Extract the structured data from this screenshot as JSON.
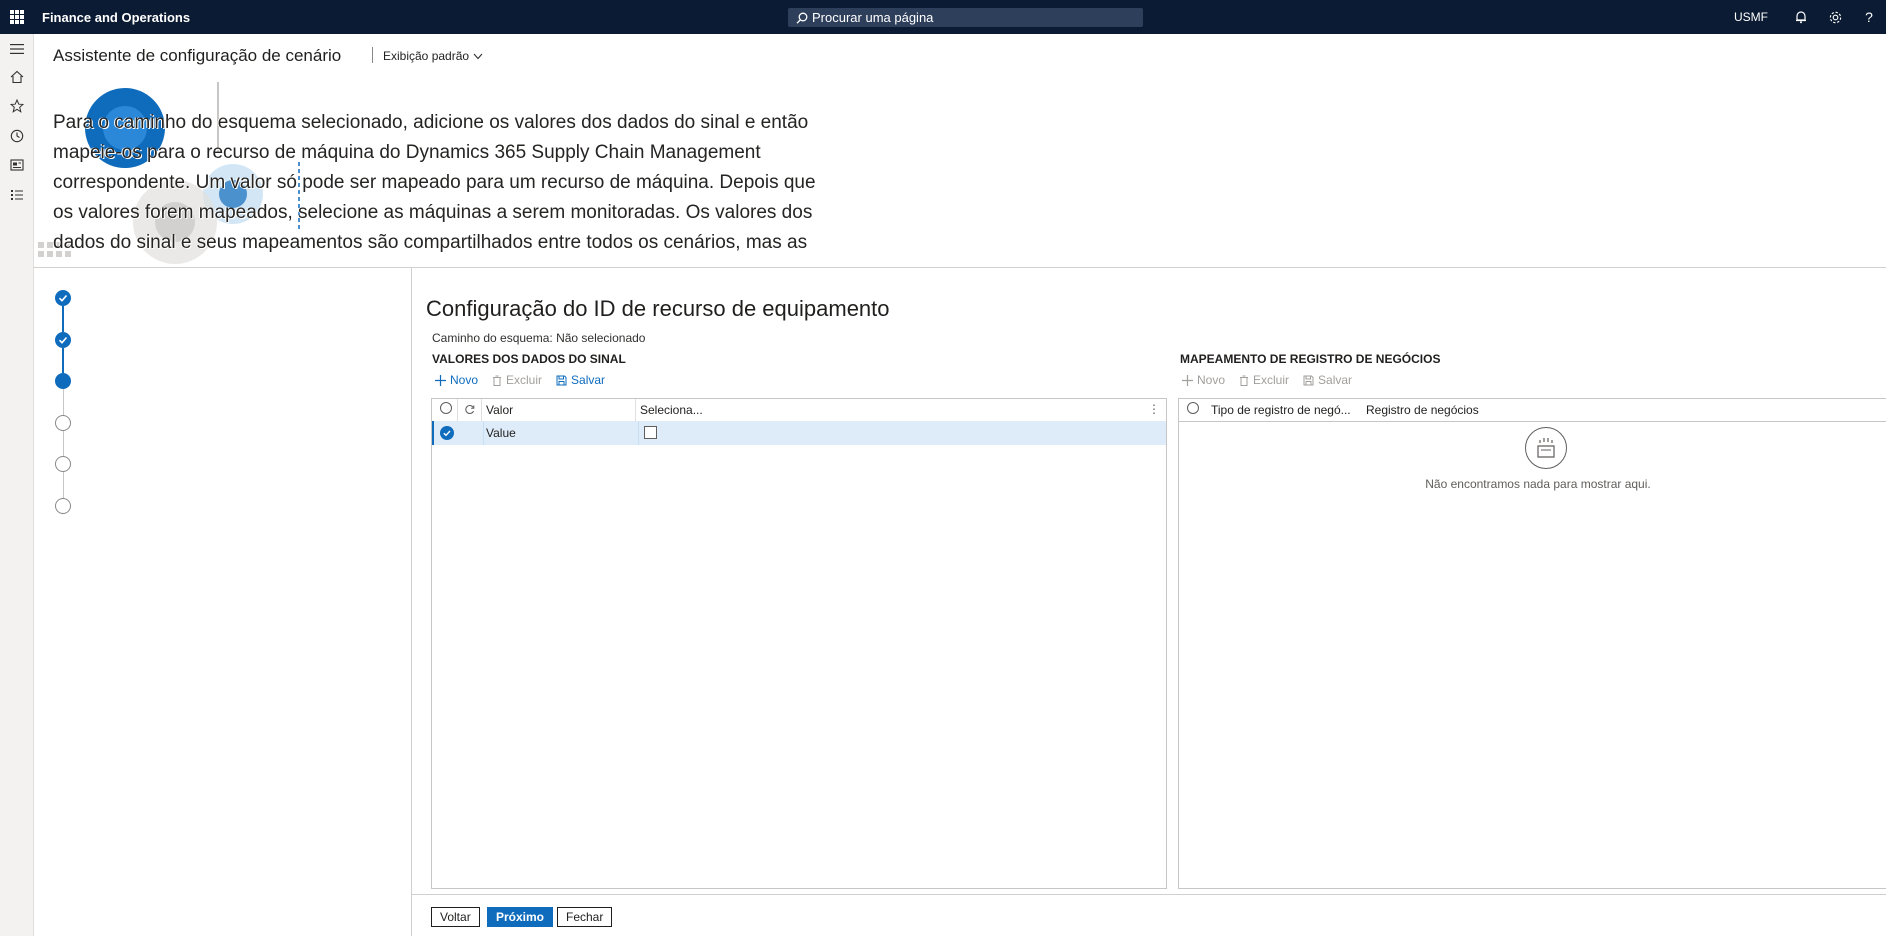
{
  "topbar": {
    "app_title": "Finance and Operations",
    "search_placeholder": "Procurar uma página",
    "company": "USMF",
    "icons": [
      "waffle-icon",
      "search-icon",
      "bell-icon",
      "gear-icon",
      "help-icon"
    ],
    "background_color": "#0b1b33"
  },
  "leftnav": {
    "icons": [
      "hamburger-icon",
      "home-icon",
      "star-icon",
      "clock-icon",
      "workspace-icon",
      "list-icon"
    ]
  },
  "header": {
    "title": "Assistente de configuração de cenário",
    "view_selector": "Exibição padrão"
  },
  "banner": {
    "text_overlay_fragment": "Para o caminho do esquema selecionado, adicione os valores dos dados do sinal",
    "text_lines": [
      "Para o caminho do esquema selecionado, adicione os valores dos dados do sinal e então",
      "mapeie-os para o recurso de máquina do Dynamics 365 Supply Chain Management",
      "correspondente. Um valor só pode ser mapeado para um recurso de máquina. Depois que",
      "os valores forem mapeados, selecione as máquinas a serem monitoradas. Os valores dos",
      "dados do sinal e seus mapeamentos são compartilhados entre todos os cenários, mas as"
    ]
  },
  "steps": [
    {
      "state": "done"
    },
    {
      "state": "done"
    },
    {
      "state": "current"
    },
    {
      "state": "todo"
    },
    {
      "state": "todo"
    },
    {
      "state": "todo"
    }
  ],
  "main": {
    "section_title": "Configuração do ID de recurso de equipamento",
    "schema_path": "Caminho do esquema: Não selecionado"
  },
  "signal_values": {
    "title": "VALORES DOS DADOS DO SINAL",
    "actions": {
      "new": "Novo",
      "delete": "Excluir",
      "save": "Salvar"
    },
    "columns": {
      "value": "Valor",
      "selected": "Seleciona..."
    },
    "rows": [
      {
        "value": "Value",
        "selected": false
      }
    ]
  },
  "business_mapping": {
    "title": "MAPEAMENTO DE REGISTRO DE NEGÓCIOS",
    "actions": {
      "new": "Novo",
      "delete": "Excluir",
      "save": "Salvar"
    },
    "columns": {
      "type": "Tipo de registro de negó...",
      "record": "Registro de negócios"
    },
    "empty_message": "Não encontramos nada para mostrar aqui."
  },
  "footer": {
    "back": "Voltar",
    "next": "Próximo",
    "close": "Fechar"
  },
  "colors": {
    "accent": "#0f6cbd",
    "selected_row": "#deecf9"
  }
}
